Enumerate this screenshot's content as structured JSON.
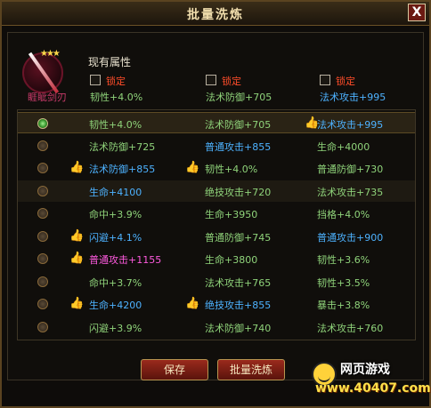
{
  "window": {
    "title": "批量洗炼",
    "close_label": "X"
  },
  "item": {
    "name": "睚眦剑刃",
    "stars": "★★★"
  },
  "current": {
    "label": "现有属性",
    "lock_label": "锁定",
    "attrs": [
      {
        "text": "韧性+4.0%",
        "color": "green"
      },
      {
        "text": "法术防御+705",
        "color": "green"
      },
      {
        "text": "法术攻击+995",
        "color": "blue"
      }
    ]
  },
  "rows": [
    {
      "selected": true,
      "cells": [
        {
          "text": "韧性+4.0%",
          "color": "green",
          "thumb": false
        },
        {
          "text": "法术防御+705",
          "color": "green",
          "thumb": false
        },
        {
          "text": "法术攻击+995",
          "color": "blue",
          "thumb": true
        }
      ]
    },
    {
      "selected": false,
      "cells": [
        {
          "text": "法术防御+725",
          "color": "green",
          "thumb": false
        },
        {
          "text": "普通攻击+855",
          "color": "blue",
          "thumb": false
        },
        {
          "text": "生命+4000",
          "color": "green",
          "thumb": false
        }
      ]
    },
    {
      "selected": false,
      "cells": [
        {
          "text": "法术防御+855",
          "color": "blue",
          "thumb": true
        },
        {
          "text": "韧性+4.0%",
          "color": "green",
          "thumb": true
        },
        {
          "text": "普通防御+730",
          "color": "green",
          "thumb": false
        }
      ]
    },
    {
      "selected": false,
      "cells": [
        {
          "text": "生命+4100",
          "color": "blue",
          "thumb": false
        },
        {
          "text": "绝技攻击+720",
          "color": "green",
          "thumb": false
        },
        {
          "text": "法术攻击+735",
          "color": "green",
          "thumb": false
        }
      ]
    },
    {
      "selected": false,
      "cells": [
        {
          "text": "命中+3.9%",
          "color": "green",
          "thumb": false
        },
        {
          "text": "生命+3950",
          "color": "green",
          "thumb": false
        },
        {
          "text": "挡格+4.0%",
          "color": "green",
          "thumb": false
        }
      ]
    },
    {
      "selected": false,
      "cells": [
        {
          "text": "闪避+4.1%",
          "color": "blue",
          "thumb": true
        },
        {
          "text": "普通防御+745",
          "color": "green",
          "thumb": false
        },
        {
          "text": "普通攻击+900",
          "color": "blue",
          "thumb": false
        }
      ]
    },
    {
      "selected": false,
      "cells": [
        {
          "text": "普通攻击+1155",
          "color": "pink",
          "thumb": true
        },
        {
          "text": "生命+3800",
          "color": "green",
          "thumb": false
        },
        {
          "text": "韧性+3.6%",
          "color": "green",
          "thumb": false
        }
      ]
    },
    {
      "selected": false,
      "cells": [
        {
          "text": "命中+3.7%",
          "color": "green",
          "thumb": false
        },
        {
          "text": "法术攻击+765",
          "color": "green",
          "thumb": false
        },
        {
          "text": "韧性+3.5%",
          "color": "green",
          "thumb": false
        }
      ]
    },
    {
      "selected": false,
      "cells": [
        {
          "text": "生命+4200",
          "color": "blue",
          "thumb": true
        },
        {
          "text": "绝技攻击+855",
          "color": "blue",
          "thumb": true
        },
        {
          "text": "暴击+3.8%",
          "color": "green",
          "thumb": false
        }
      ]
    },
    {
      "selected": false,
      "cells": [
        {
          "text": "闪避+3.9%",
          "color": "green",
          "thumb": false
        },
        {
          "text": "法术防御+740",
          "color": "green",
          "thumb": false
        },
        {
          "text": "法术攻击+760",
          "color": "green",
          "thumb": false
        }
      ]
    }
  ],
  "buttons": {
    "save": "保存",
    "batch_refine": "批量洗炼"
  },
  "watermark": {
    "title": "网页游戏",
    "url": "www.40407.com"
  },
  "icons": {
    "thumb": "thumbs-up-icon",
    "radio": "radio-icon",
    "close": "close-icon"
  },
  "colors": {
    "green": "#8fd37a",
    "blue": "#4db2ff",
    "pink": "#ff5adf",
    "lock": "#ff4d2a",
    "accent": "#9a2a1c"
  }
}
